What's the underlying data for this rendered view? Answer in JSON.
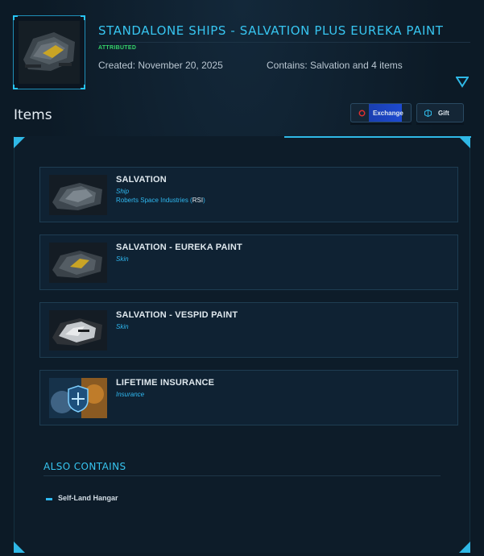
{
  "header": {
    "title": "STANDALONE SHIPS - SALVATION PLUS EUREKA PAINT",
    "status": "ATTRIBUTED",
    "created": "Created: November 20, 2025",
    "contains": "Contains: Salvation and 4 items"
  },
  "items_heading": "Items",
  "actions": {
    "exchange_label": "Exchange",
    "gift_label": "Gift"
  },
  "items": [
    {
      "name": "SALVATION",
      "type": "Ship",
      "maker_prefix": "Roberts Space Industries (",
      "maker_code": "RSI",
      "maker_suffix": ")",
      "thumb": "ship-grey"
    },
    {
      "name": "SALVATION - EUREKA PAINT",
      "type": "Skin",
      "thumb": "ship-yellow"
    },
    {
      "name": "SALVATION - VESPID PAINT",
      "type": "Skin",
      "thumb": "ship-white"
    },
    {
      "name": "LIFETIME INSURANCE",
      "type": "Insurance",
      "thumb": "insurance-shield"
    }
  ],
  "also_contains": {
    "heading": "ALSO CONTAINS",
    "entries": [
      "Self-Land Hangar"
    ]
  },
  "colors": {
    "accent": "#37c5f0",
    "status_green": "#35d36a",
    "exchange_blue": "#1d4ad0"
  },
  "icons": {
    "toggle": "chevron-down-triangle-icon",
    "exchange": "exchange-circle-icon",
    "gift": "gift-cube-icon"
  }
}
